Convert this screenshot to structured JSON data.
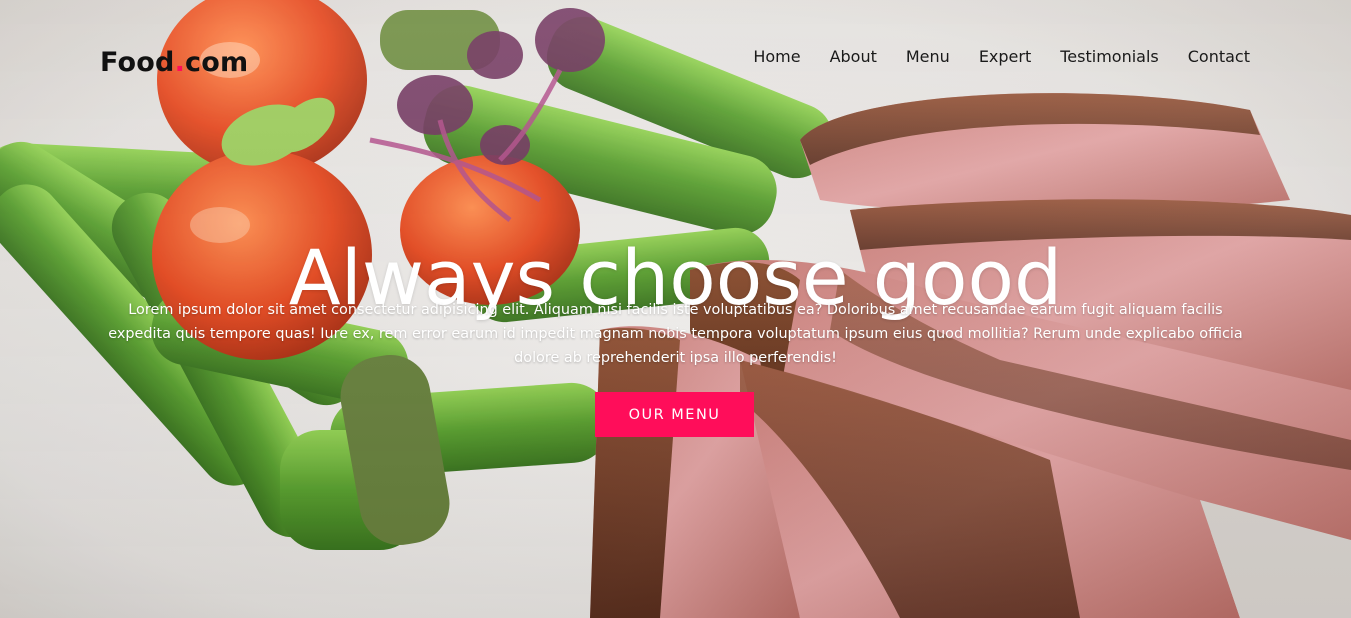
{
  "brand": {
    "name_part1": "Food",
    "name_dot": ".",
    "name_part2": "com",
    "accent_color": "#ff0d5a"
  },
  "nav": {
    "items": [
      {
        "label": "Home"
      },
      {
        "label": "About"
      },
      {
        "label": "Menu"
      },
      {
        "label": "Expert"
      },
      {
        "label": "Testimonials"
      },
      {
        "label": "Contact"
      }
    ]
  },
  "hero": {
    "title": "Always choose good",
    "description": "Lorem ipsum dolor sit amet consectetur adipisicing elit. Aliquam nisi facilis iste voluptatibus ea? Doloribus amet recusandae earum fugit aliquam facilis expedita quis tempore quas! Iure ex, rem error earum id impedit magnam nobis tempora voluptatum ipsum eius quod mollitia? Rerum unde explicabo officia dolore ab reprehenderit ipsa illo perferendis!",
    "cta_label": "Our Menu",
    "background_image": "food-plate-steak-asparagus-tomatoes"
  }
}
